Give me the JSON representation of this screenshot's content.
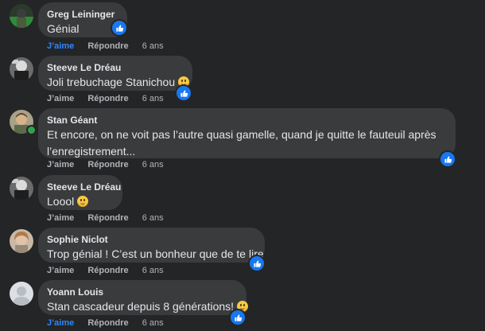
{
  "actions": {
    "like": "J’aime",
    "reply": "Répondre"
  },
  "comments": [
    {
      "author": "Greg Leininger",
      "text": "Génial",
      "time": "6 ans",
      "liked": true,
      "emoji": false,
      "reaction": true
    },
    {
      "author": "Steeve Le Dréau",
      "text": "Joli trebuchage Stanichou",
      "time": "6 ans",
      "liked": false,
      "emoji": true,
      "reaction": true
    },
    {
      "author": "Stan Géant",
      "text_lines": [
        "Et encore, on ne voit pas l’autre quasi gamelle, quand je quitte le fauteuil après",
        "l’enregistrement..."
      ],
      "time": "6 ans",
      "liked": false,
      "emoji": false,
      "reaction": true,
      "online": true
    },
    {
      "author": "Steeve Le Dréau",
      "text": "Loool",
      "time": "6 ans",
      "liked": false,
      "emoji": true,
      "reaction": false
    },
    {
      "author": "Sophie Niclot",
      "text": "Trop génial ! C’est un bonheur que de te lire",
      "time": "6 ans",
      "liked": false,
      "emoji": false,
      "reaction": true
    },
    {
      "author": "Yoann Louis",
      "text": "Stan cascadeur depuis 8 générations!",
      "time": "6 ans",
      "liked": true,
      "emoji": true,
      "reaction": true
    }
  ]
}
